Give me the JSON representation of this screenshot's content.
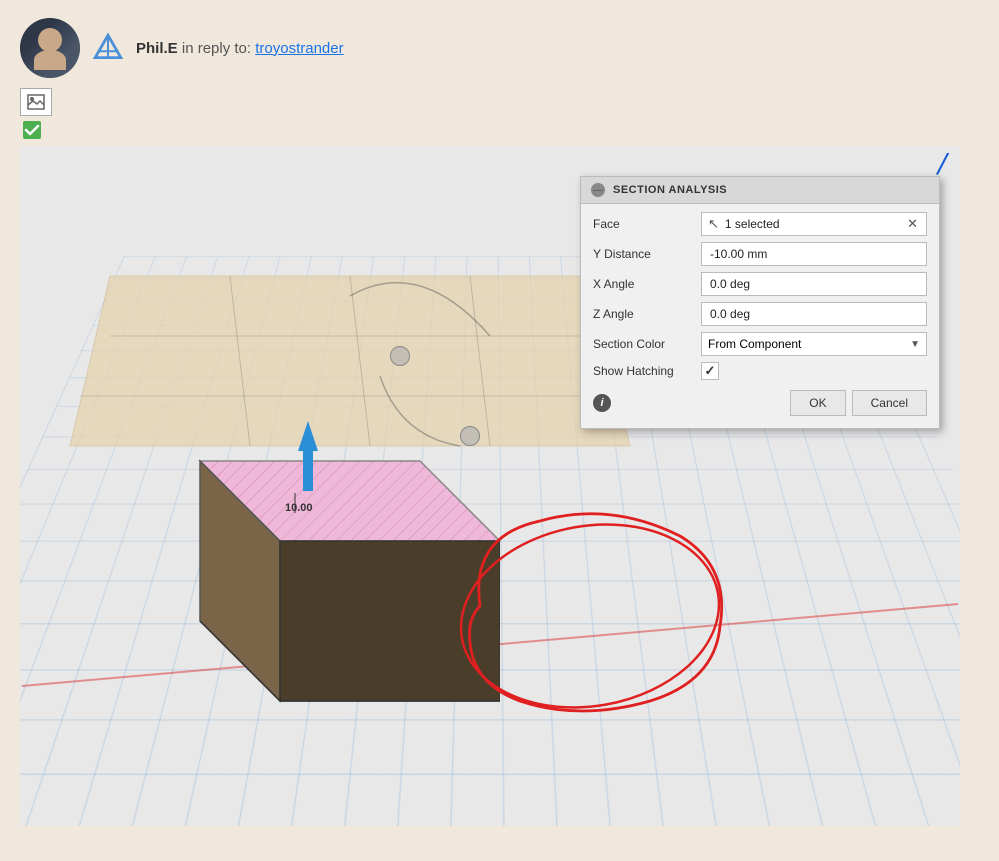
{
  "header": {
    "username": "Phil.E",
    "reply_prefix": "in reply to:",
    "reply_user": "troyostrander"
  },
  "icons": {
    "image_icon": "🖼",
    "check_icon": "✓"
  },
  "viewport": {
    "blue_corner": "╱"
  },
  "dialog": {
    "title": "SECTION ANALYSIS",
    "minimize_symbol": "—",
    "fields": {
      "face_label": "Face",
      "face_value": "1 selected",
      "y_distance_label": "Y Distance",
      "y_distance_value": "-10.00 mm",
      "x_angle_label": "X Angle",
      "x_angle_value": "0.0 deg",
      "z_angle_label": "Z Angle",
      "z_angle_value": "0.0 deg",
      "section_color_label": "Section Color",
      "section_color_value": "From Component",
      "show_hatching_label": "Show Hatching"
    },
    "buttons": {
      "ok": "OK",
      "cancel": "Cancel"
    }
  },
  "distance_label": "10.00"
}
